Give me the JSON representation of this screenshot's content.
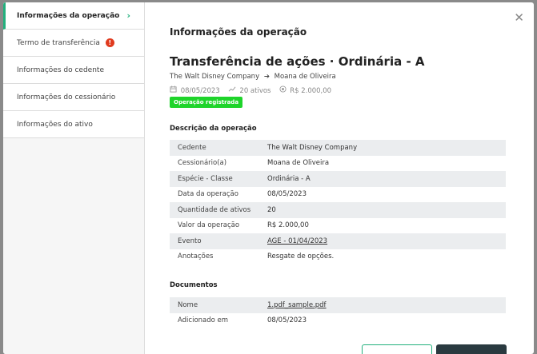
{
  "sidebar": {
    "items": [
      {
        "label": "Informações da operação"
      },
      {
        "label": "Termo de transferência"
      },
      {
        "label": "Informações do cedente"
      },
      {
        "label": "Informações do cessionário"
      },
      {
        "label": "Informações do ativo"
      }
    ],
    "active_chevron": "›",
    "warning_glyph": "!"
  },
  "header": {
    "close_glyph": "✕",
    "title": "Informações da operação"
  },
  "operation": {
    "title": "Transferência de ações · Ordinária - A",
    "from": "The Walt Disney Company",
    "arrow": "➔",
    "to": "Moana de Oliveira",
    "date": "08/05/2023",
    "assets": "20 ativos",
    "value": "R$ 2.000,00",
    "status": "Operação registrada",
    "status_color": "#1ed42a"
  },
  "description": {
    "title": "Descrição da operação",
    "rows": [
      {
        "k": "Cedente",
        "v": "The Walt Disney Company"
      },
      {
        "k": "Cessionário(a)",
        "v": "Moana de Oliveira"
      },
      {
        "k": "Espécie - Classe",
        "v": "Ordinária - A"
      },
      {
        "k": "Data da operação",
        "v": "08/05/2023"
      },
      {
        "k": "Quantidade de ativos",
        "v": "20"
      },
      {
        "k": "Valor da operação",
        "v": "R$ 2.000,00"
      },
      {
        "k": "Evento",
        "v": "AGE - 01/04/2023"
      },
      {
        "k": "Anotações",
        "v": "Resgate de opções."
      }
    ]
  },
  "documents": {
    "title": "Documentos",
    "rows": [
      {
        "k": "Nome",
        "v": "1.pdf_sample.pdf"
      },
      {
        "k": "Adicionado em",
        "v": "08/05/2023"
      }
    ]
  },
  "colors": {
    "accent": "#22b07d",
    "warning": "#e03a1e",
    "dark_button": "#2a3a40"
  }
}
